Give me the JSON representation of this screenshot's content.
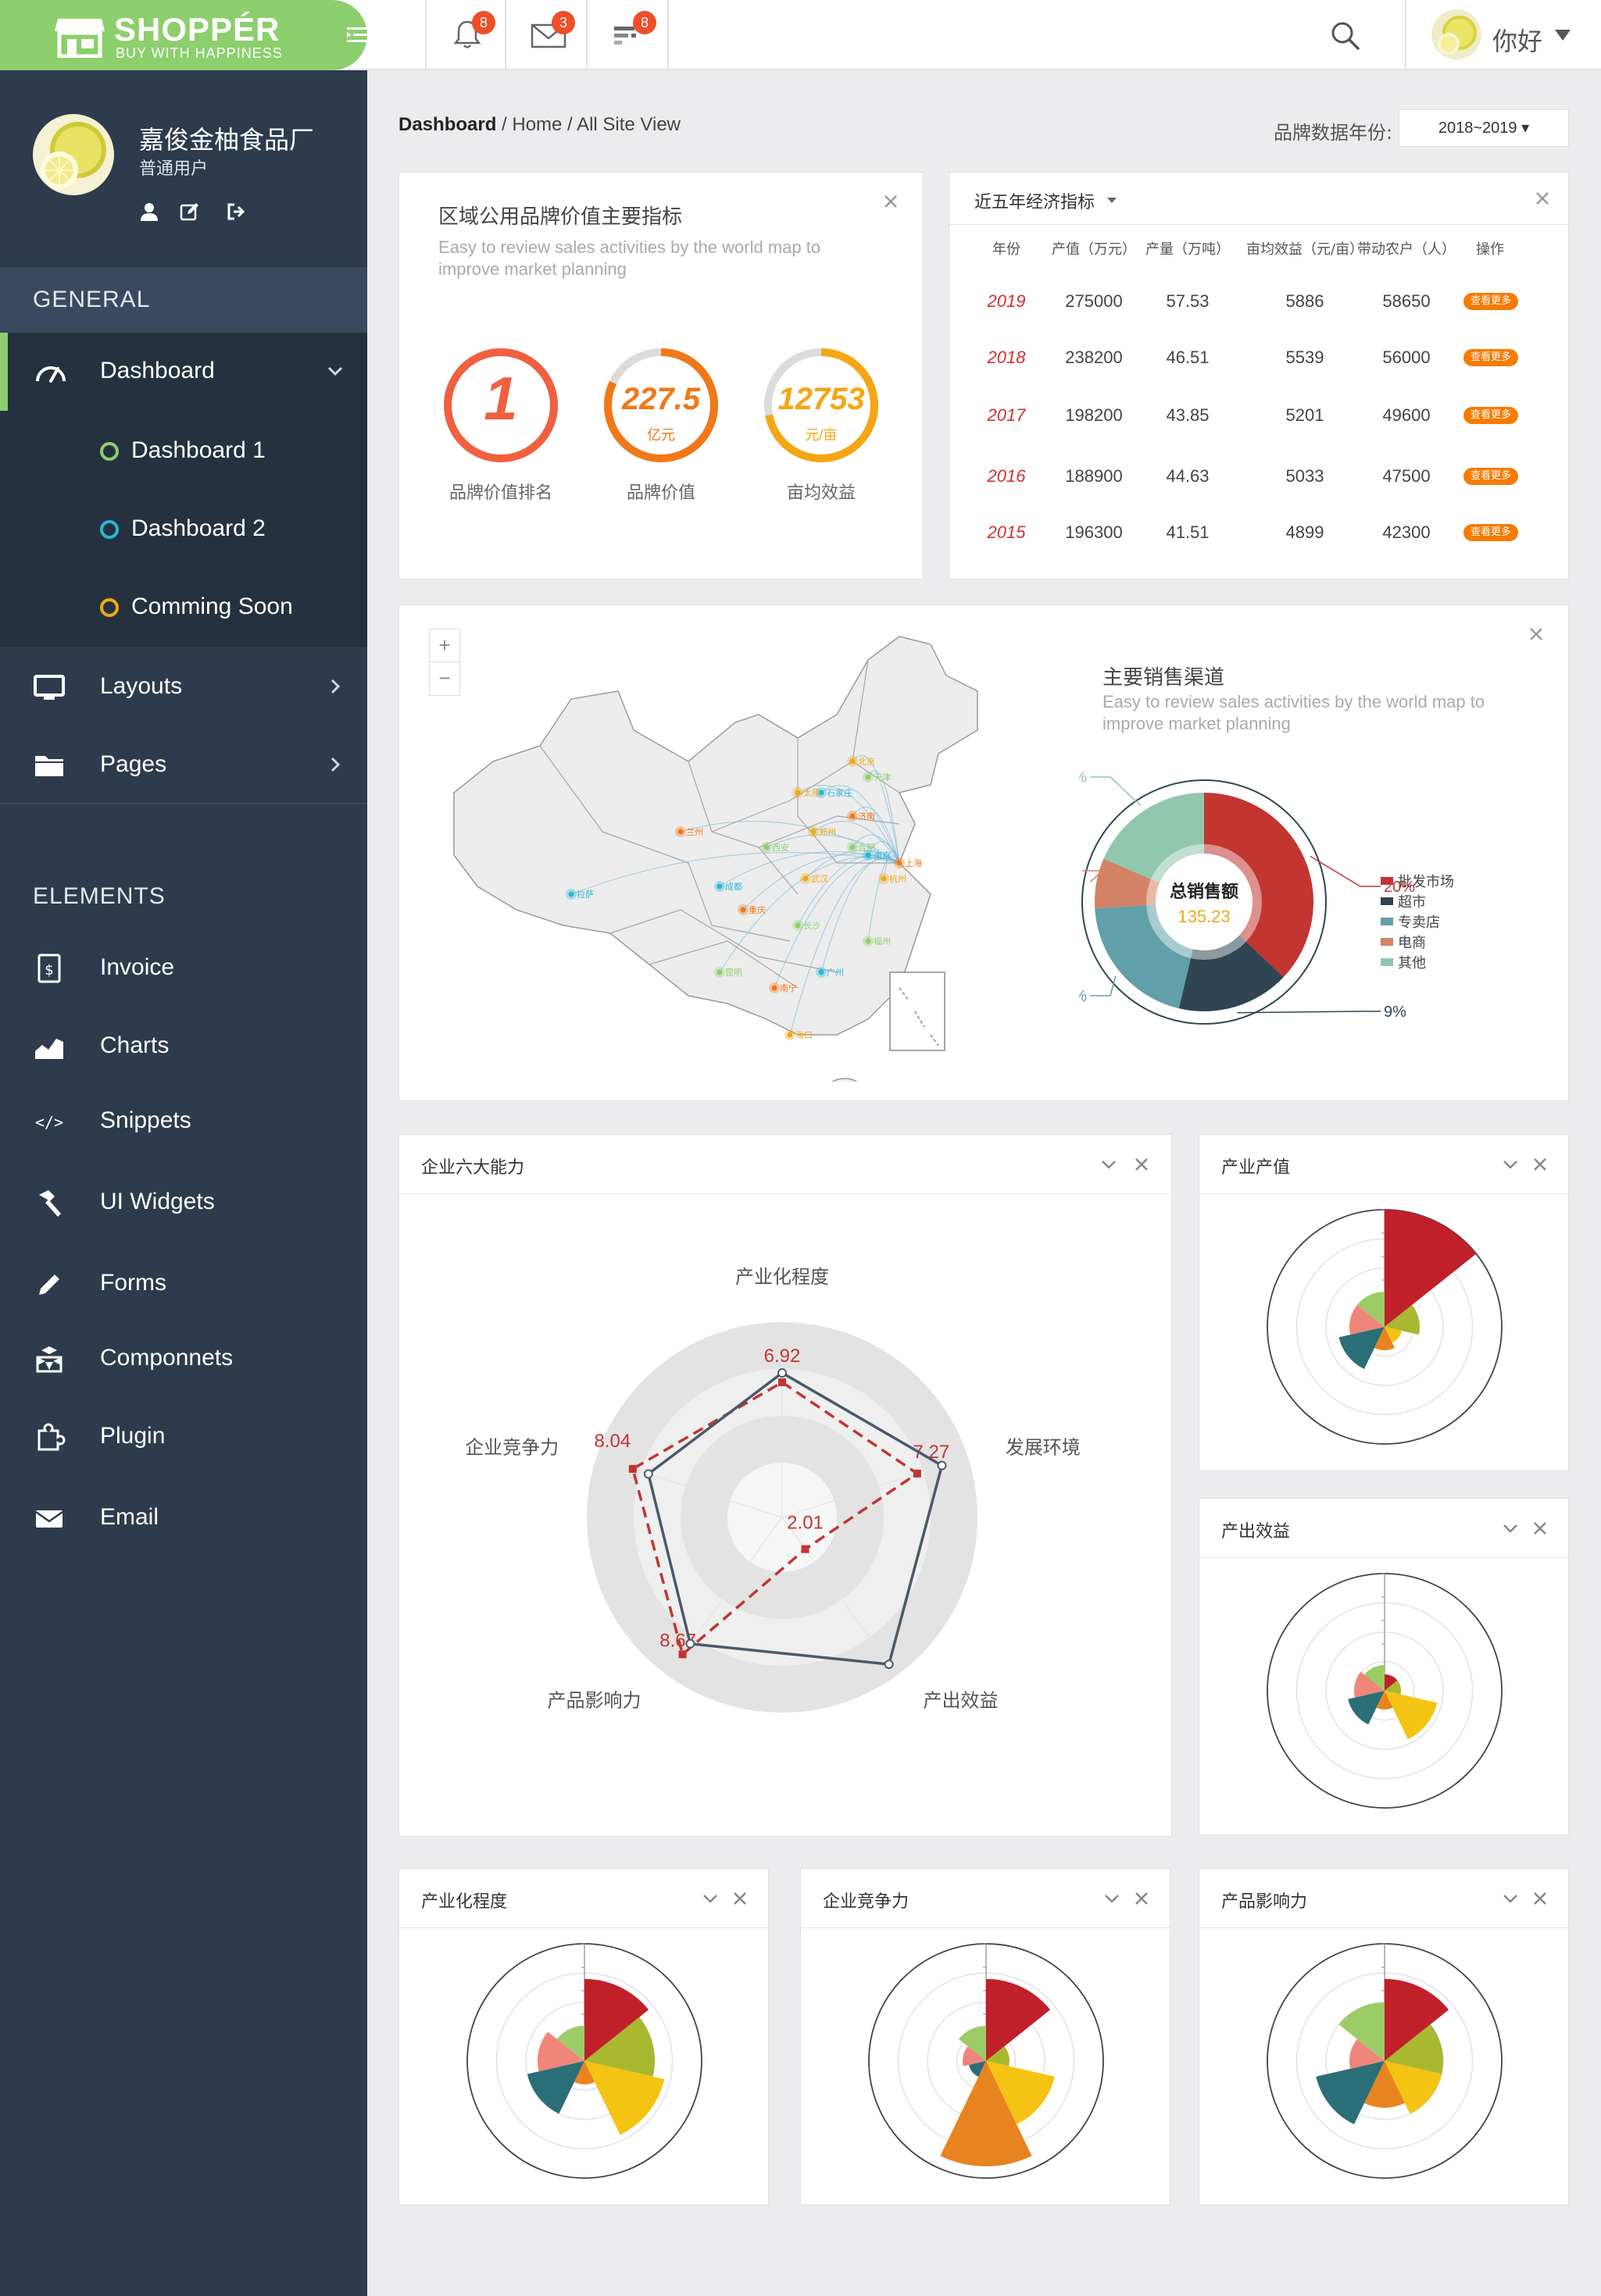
{
  "brand": {
    "name": "SHOPPÉR",
    "slogan": "BUY WITH HAPPINESS"
  },
  "header": {
    "notifications": {
      "bell": "8",
      "mail": "3",
      "tasks": "8"
    },
    "user_name": "你好"
  },
  "sidebar": {
    "profile": {
      "name": "嘉俊金柚食品厂",
      "role": "普通用户"
    },
    "sections": {
      "general": "GENERAL",
      "elements": "ELEMENTS"
    },
    "dashboard_label": "Dashboard",
    "submenu": [
      {
        "label": "Dashboard 1",
        "color": "#8ccf6c"
      },
      {
        "label": "Dashboard 2",
        "color": "#29b6d8"
      },
      {
        "label": "Comming Soon",
        "color": "#f0a818"
      }
    ],
    "layouts_label": "Layouts",
    "pages_label": "Pages",
    "elements": [
      {
        "label": "Invoice",
        "icon": "invoice-icon"
      },
      {
        "label": "Charts",
        "icon": "charts-icon"
      },
      {
        "label": "Snippets",
        "icon": "code-icon"
      },
      {
        "label": "UI Widgets",
        "icon": "hammer-icon"
      },
      {
        "label": "Forms",
        "icon": "pencil-icon"
      },
      {
        "label": "Componnets",
        "icon": "cubes-icon"
      },
      {
        "label": "Plugin",
        "icon": "puzzle-icon"
      },
      {
        "label": "Email",
        "icon": "envelope-icon"
      }
    ]
  },
  "breadcrumb": {
    "current": "Dashboard",
    "trail": " / Home / All Site View"
  },
  "year_filter": {
    "label": "品牌数据年份:",
    "value": "2018~2019 ▾"
  },
  "kpi": {
    "title": "区域公用品牌价值主要指标",
    "subtitle": "Easy to review sales activities by the world map to improve market planning",
    "gauges": [
      {
        "value": "1",
        "unit": "",
        "label": "品牌价值排名",
        "color": "#f06040",
        "fraction": 1.0
      },
      {
        "value": "227.5",
        "unit": "亿元",
        "label": "品牌价值",
        "color": "#f07818",
        "fraction": 0.82
      },
      {
        "value": "12753",
        "unit": "元/亩",
        "label": "亩均效益",
        "color": "#f5a613",
        "fraction": 0.72
      }
    ]
  },
  "economy": {
    "title": "近五年经济指标",
    "columns": [
      "年份",
      "产值（万元）",
      "产量（万吨）",
      "亩均效益（元/亩）",
      "带动农户（人）",
      "操作"
    ],
    "rows": [
      [
        "2019",
        "275000",
        "57.53",
        "5886",
        "58650"
      ],
      [
        "2018",
        "238200",
        "46.51",
        "5539",
        "56000"
      ],
      [
        "2017",
        "198200",
        "43.85",
        "5201",
        "49600"
      ],
      [
        "2016",
        "188900",
        "44.63",
        "5033",
        "47500"
      ],
      [
        "2015",
        "196300",
        "41.51",
        "4899",
        "42300"
      ]
    ],
    "action_label": "查看更多"
  },
  "map": {
    "zoom_in": "+",
    "zoom_out": "−",
    "cities": [
      "北京",
      "天津",
      "石家庄",
      "济南",
      "郑州",
      "西安",
      "成都",
      "重庆",
      "武汉",
      "长沙",
      "南京",
      "上海",
      "杭州",
      "福州",
      "广州",
      "南宁",
      "海口",
      "昆明",
      "拉萨",
      "兰州",
      "太原",
      "合肥"
    ]
  },
  "sales": {
    "title": "主要销售渠道",
    "subtitle": "Easy to review sales activities by the world map to improve market planning",
    "center_title": "总销售额",
    "center_value": "135.23"
  },
  "chart_data": [
    {
      "type": "pie",
      "title": "主要销售渠道",
      "categories": [
        "批发市场",
        "超市",
        "专卖店",
        "电商",
        "其他"
      ],
      "values": [
        20,
        9,
        11,
        4,
        10
      ],
      "value_labels": [
        "20%",
        "9%",
        "11%",
        "4%",
        "10%"
      ],
      "colors": [
        "#c23531",
        "#2f4554",
        "#61a0a8",
        "#d48265",
        "#91c7ae"
      ]
    },
    {
      "type": "radar",
      "title": "企业六大能力",
      "indicators": [
        "产业化程度",
        "发展环境",
        "产出效益",
        "产品影响力",
        "企业竞争力"
      ],
      "series": [
        {
          "values": [
            6.92,
            7.27,
            2.01,
            8.67,
            8.04
          ],
          "style": "dashed",
          "color": "#c23531"
        },
        {
          "values": [
            7.4,
            8.6,
            9.3,
            8.0,
            7.2
          ],
          "style": "solid",
          "color": "#4a5a6a"
        }
      ],
      "value_labels": [
        "6.92",
        "7.27",
        "2.01",
        "8.67",
        "8.04"
      ]
    },
    {
      "type": "polar-bar",
      "title": "产业产值",
      "values": [
        10,
        3,
        1.5,
        2,
        4,
        3,
        3
      ],
      "colors": [
        "#c0202a",
        "#a8b830",
        "#f5c313",
        "#e88420",
        "#2a6e78",
        "#f0857a",
        "#9ccc65"
      ]
    },
    {
      "type": "polar-bar",
      "title": "产出效益",
      "values": [
        1.4,
        1.4,
        4.6,
        1.6,
        3.2,
        2.6,
        2.2
      ],
      "colors": [
        "#c0202a",
        "#a8b830",
        "#f5c313",
        "#e88420",
        "#2a6e78",
        "#f0857a",
        "#9ccc65"
      ]
    },
    {
      "type": "polar-bar",
      "title": "产业化程度",
      "values": [
        7,
        6,
        7,
        2,
        5,
        4,
        3
      ],
      "colors": [
        "#c0202a",
        "#a8b830",
        "#f5c313",
        "#e88420",
        "#2a6e78",
        "#f0857a",
        "#9ccc65"
      ]
    },
    {
      "type": "polar-bar",
      "title": "企业竞争力",
      "values": [
        7,
        2,
        6,
        9,
        1.5,
        2,
        3
      ],
      "colors": [
        "#c0202a",
        "#a8b830",
        "#f5c313",
        "#e88420",
        "#2a6e78",
        "#f0857a",
        "#9ccc65"
      ]
    },
    {
      "type": "polar-bar",
      "title": "产品影响力",
      "values": [
        7,
        5,
        5,
        4,
        6,
        3,
        5
      ],
      "colors": [
        "#c0202a",
        "#a8b830",
        "#f5c313",
        "#e88420",
        "#2a6e78",
        "#f0857a",
        "#9ccc65"
      ]
    }
  ],
  "panels": {
    "radar_title": "企业六大能力",
    "output_title": "产业产值",
    "benefit_title": "产出效益",
    "industry_title": "产业化程度",
    "compete_title": "企业竞争力",
    "influence_title": "产品影响力"
  }
}
